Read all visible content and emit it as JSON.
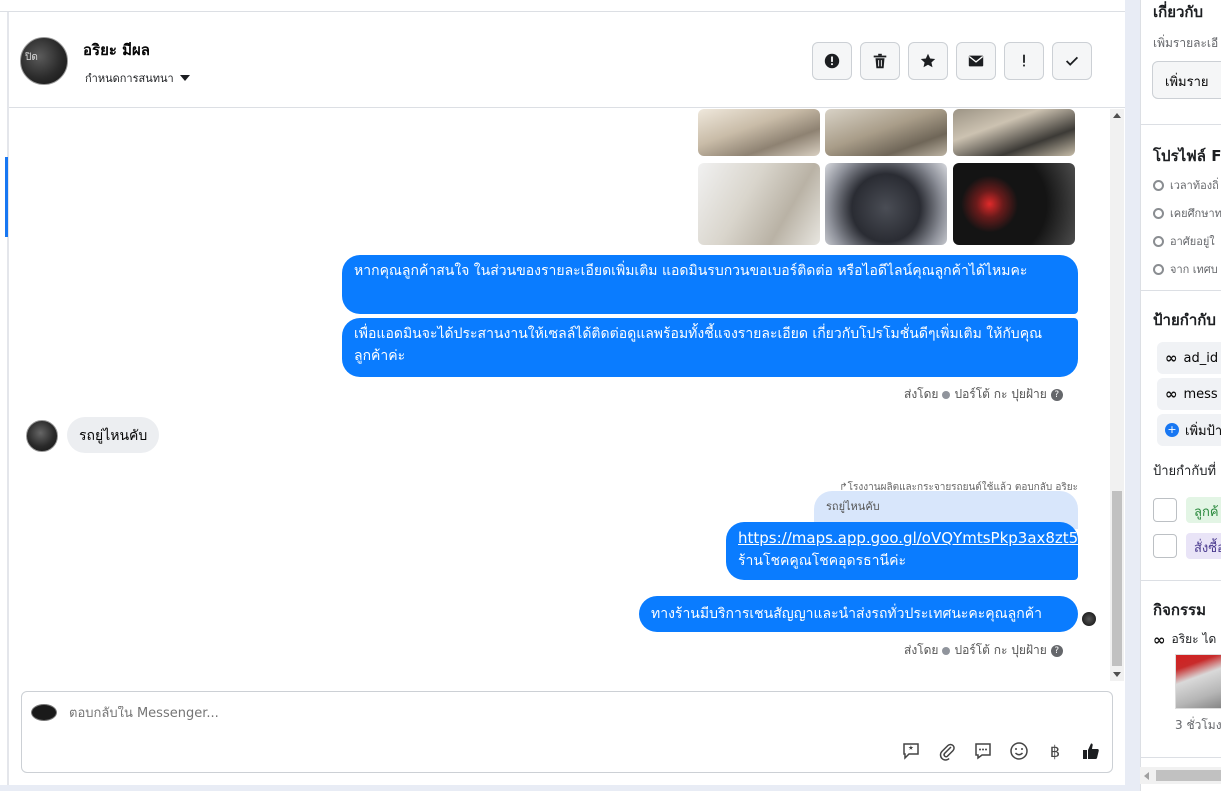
{
  "header": {
    "avatar_label": "ปิด",
    "name": "อริยะ มีผล",
    "subtitle": "กำหนดการสนทนา",
    "actions": [
      {
        "name": "spam-button",
        "icon": "alert-circle-icon"
      },
      {
        "name": "delete-button",
        "icon": "trash-icon"
      },
      {
        "name": "star-button",
        "icon": "star-icon"
      },
      {
        "name": "mark-unread-button",
        "icon": "envelope-icon"
      },
      {
        "name": "follow-up-button",
        "icon": "exclamation-icon"
      },
      {
        "name": "done-button",
        "icon": "check-icon"
      }
    ]
  },
  "messages": {
    "outgoing_1": "หากคุณลูกค้าสนใจ ในส่วนของรายละเอียดเพิ่มเติม แอดมินรบกวนขอเบอร์ติดต่อ หรือไอดีไลน์คุณลูกค้าได้ไหมคะ",
    "outgoing_2": "เพื่อแอดมินจะได้ประสานงานให้เซลล์ได้ติดต่อดูแลพร้อมทั้งชี้แจงรายละเอียด เกี่ยวกับโปรโมชั่นดีๆเพิ่มเติม ให้กับคุณลูกค้าค่ะ",
    "sent_by_1": "ส่งโดย",
    "sender_1": "ปอร์โต้ กะ ปุยฝ้าย",
    "incoming_1": "รถยู่ไหนคับ",
    "reply_meta": "โรงงานผลิตและกระจายรถยนต์ใช้แล้ว ตอบกลับ อริยะ",
    "quoted": "รถยู่ไหนคับ",
    "link": "https://maps.app.goo.gl/oVQYmtsPkp3ax8zt5",
    "link_caption": "ร้านโชคคูณโชคอุดรธานีค่ะ",
    "outgoing_3": "ทางร้านมีบริการเชนสัญญาและนำส่งรถทั่วประเทศนะคะคุณลูกค้า",
    "sent_by_2": "ส่งโดย",
    "sender_2": "ปอร์โต้ กะ ปุยฝ้าย",
    "photos": [
      "car-interior-front",
      "car-interior-seats",
      "car-interior-rear",
      "car-door-panel",
      "car-engine-bay",
      "car-gauge-cluster"
    ]
  },
  "composer": {
    "placeholder": "ตอบกลับใน Messenger...",
    "tools": [
      "chat-bubble-icon",
      "paperclip-icon",
      "comment-icon",
      "smiley-icon",
      "baht-icon",
      "thumbs-up-icon"
    ],
    "baht_glyph": "฿"
  },
  "sidebar": {
    "about_title": "เกี่ยวกับ",
    "about_sub": "เพิ่มรายละเอี",
    "add_details_button": "เพิ่มราย",
    "profile_title": "โปรไฟล์ F",
    "profile_rows": [
      "เวลาท้องถิ่",
      "เคยศึกษาท",
      "อาศัยอยู่ใ",
      "จาก เทศบ"
    ],
    "labels_title": "ป้ายกำกับ",
    "labels": [
      "ad_id",
      "mess"
    ],
    "add_label": "เพิ่มป้า",
    "suggested_labels_title": "ป้ายกำกับที่",
    "suggested": [
      "ลูกค้",
      "สั่งซื้อ"
    ],
    "activity_title": "กิจกรรม",
    "activity_text": "อริยะ ได",
    "activity_time": "3 ชั่วโมง"
  },
  "colors": {
    "accent": "#0a7cff",
    "incoming_bg": "#eceef1"
  }
}
